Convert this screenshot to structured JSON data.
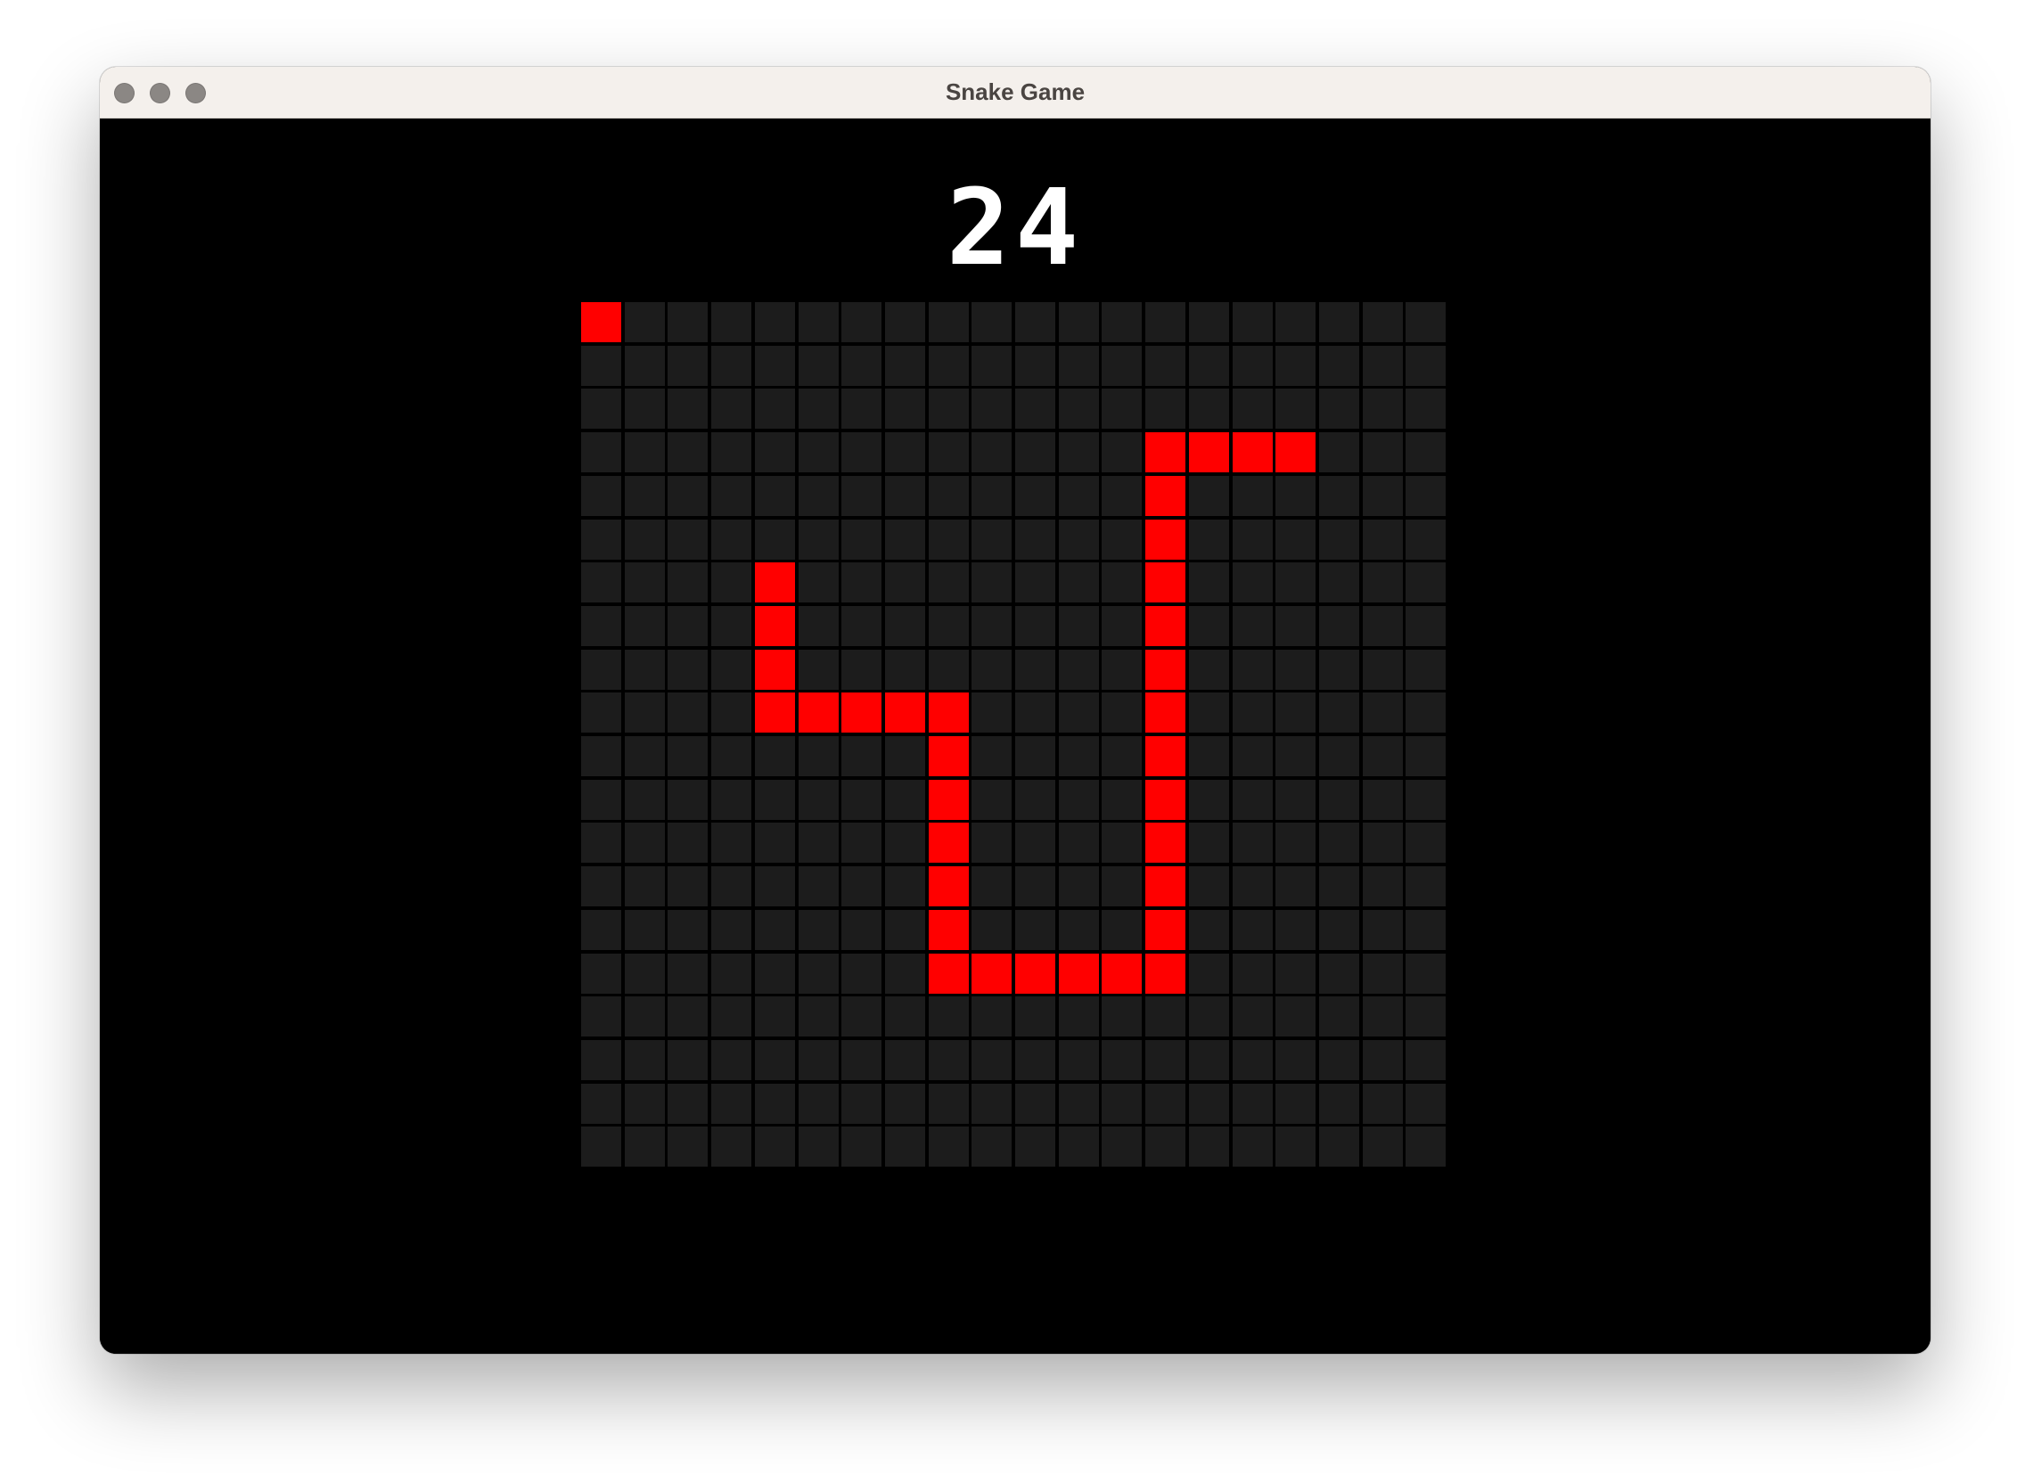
{
  "window": {
    "title": "Snake Game"
  },
  "game": {
    "score": "24",
    "grid": {
      "columns": 20,
      "rows": 20
    },
    "colors": {
      "background": "#000000",
      "cell": "#1c1c1c",
      "snake": "#ff0000",
      "food": "#ff0000",
      "score_text": "#ffffff"
    },
    "food": {
      "col": 0,
      "row": 0
    },
    "snake": [
      [
        4,
        6
      ],
      [
        4,
        7
      ],
      [
        4,
        8
      ],
      [
        4,
        9
      ],
      [
        5,
        9
      ],
      [
        6,
        9
      ],
      [
        7,
        9
      ],
      [
        8,
        9
      ],
      [
        8,
        10
      ],
      [
        8,
        11
      ],
      [
        8,
        12
      ],
      [
        8,
        13
      ],
      [
        8,
        14
      ],
      [
        8,
        15
      ],
      [
        9,
        15
      ],
      [
        10,
        15
      ],
      [
        11,
        15
      ],
      [
        12,
        15
      ],
      [
        13,
        15
      ],
      [
        13,
        14
      ],
      [
        13,
        13
      ],
      [
        13,
        12
      ],
      [
        13,
        11
      ],
      [
        13,
        10
      ],
      [
        13,
        9
      ],
      [
        13,
        8
      ],
      [
        13,
        7
      ],
      [
        13,
        6
      ],
      [
        13,
        5
      ],
      [
        13,
        4
      ],
      [
        13,
        3
      ],
      [
        14,
        3
      ],
      [
        15,
        3
      ],
      [
        16,
        3
      ]
    ]
  }
}
